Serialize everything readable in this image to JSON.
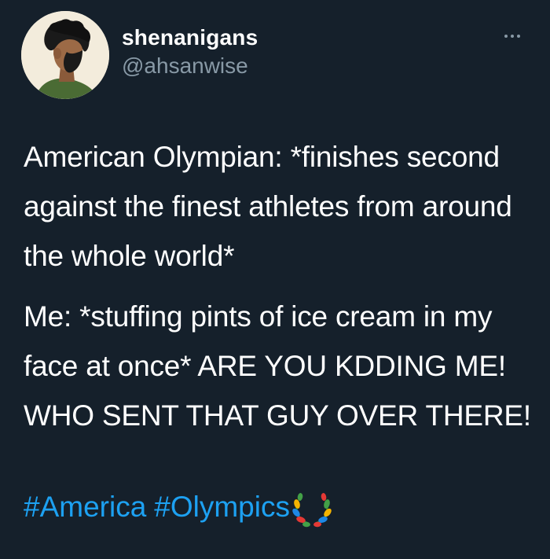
{
  "user": {
    "display_name": "shenanigans",
    "handle": "@ahsanwise"
  },
  "icons": {
    "more": "more-horizontal-icon",
    "avatar": "avatar-illustration",
    "emoji": "olympic-laurel-emoji"
  },
  "tweet": {
    "paragraph1": "American Olympian: *finishes second against the finest athletes from around the whole world*",
    "paragraph2": "Me: *stuffing pints of ice cream in my face at once* ARE YOU KDDING ME! WHO SENT THAT GUY OVER THERE!",
    "hashtags": [
      "#America",
      "#Olympics"
    ]
  },
  "colors": {
    "background": "#15202b",
    "text": "#ffffff",
    "secondary_text": "#8899a6",
    "link": "#1da1f2"
  }
}
